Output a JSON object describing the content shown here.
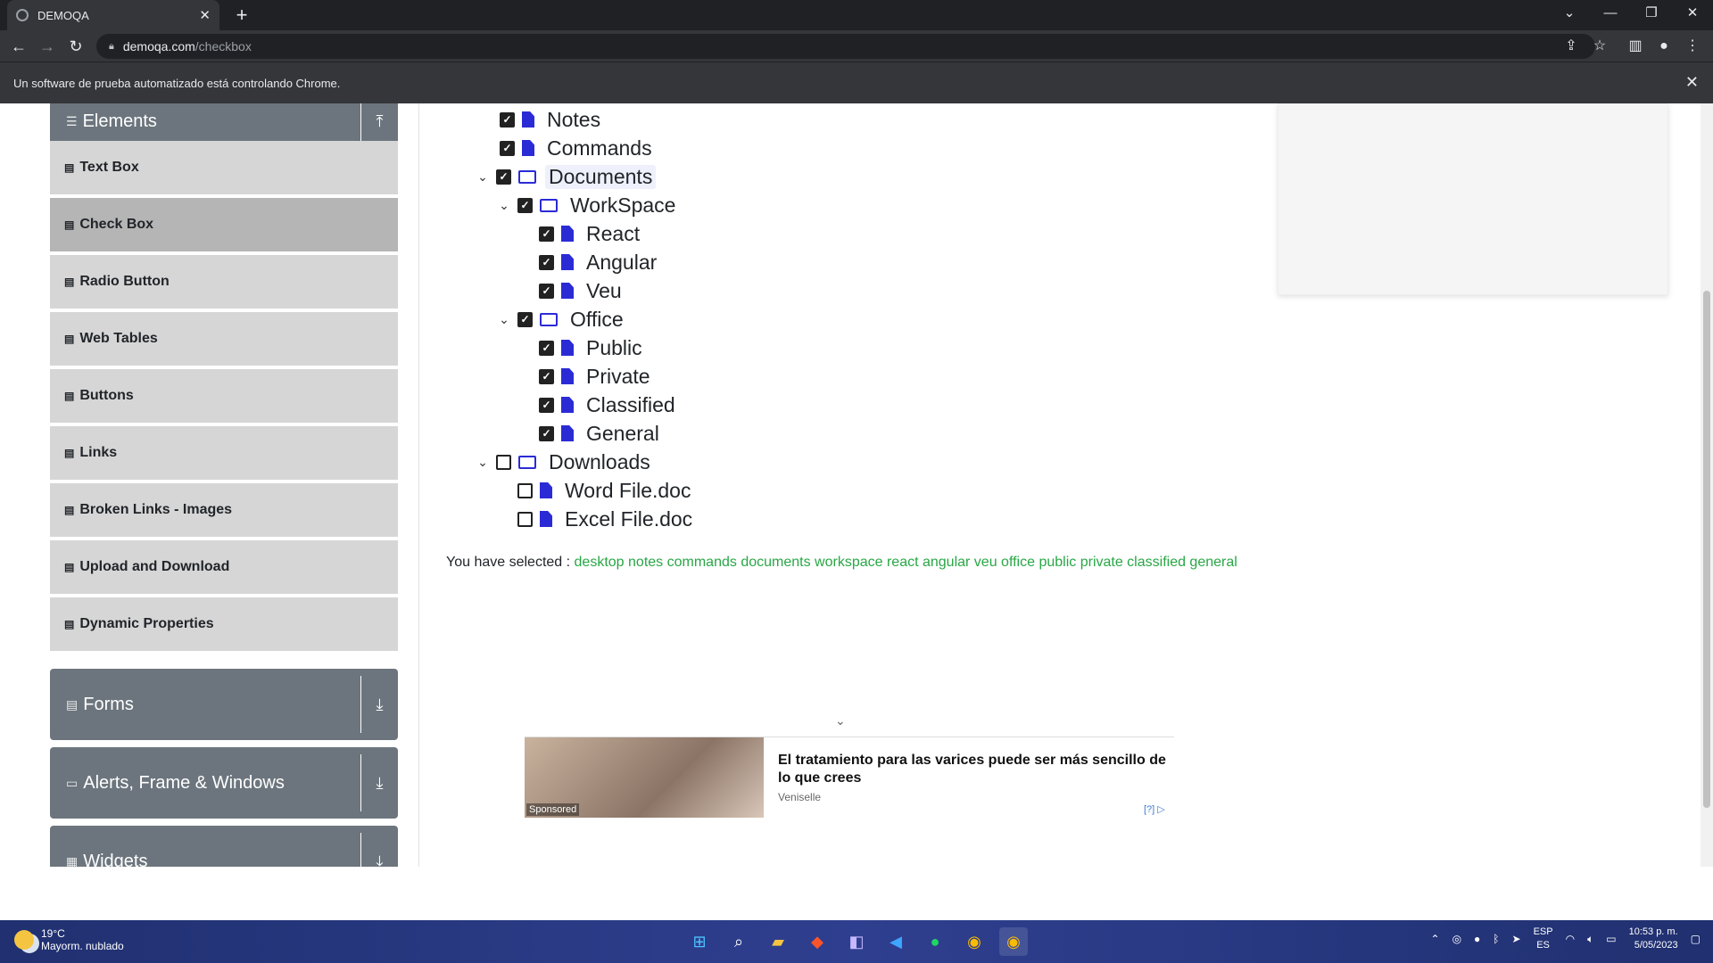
{
  "browser": {
    "tab_title": "DEMOQA",
    "url_host": "demoqa.com",
    "url_path": "/checkbox",
    "infobar_text": "Un software de prueba automatizado está controlando Chrome."
  },
  "sidebar": {
    "elements_header": "Elements",
    "items": [
      {
        "label": "Text Box"
      },
      {
        "label": "Check Box"
      },
      {
        "label": "Radio Button"
      },
      {
        "label": "Web Tables"
      },
      {
        "label": "Buttons"
      },
      {
        "label": "Links"
      },
      {
        "label": "Broken Links - Images"
      },
      {
        "label": "Upload and Download"
      },
      {
        "label": "Dynamic Properties"
      }
    ],
    "groups": [
      {
        "label": "Forms"
      },
      {
        "label": "Alerts, Frame & Windows"
      },
      {
        "label": "Widgets"
      }
    ]
  },
  "tree": {
    "notes": "Notes",
    "commands": "Commands",
    "documents": "Documents",
    "workspace": "WorkSpace",
    "react": "React",
    "angular": "Angular",
    "veu": "Veu",
    "office": "Office",
    "public": "Public",
    "private": "Private",
    "classified": "Classified",
    "general": "General",
    "downloads": "Downloads",
    "word": "Word File.doc",
    "excel": "Excel File.doc"
  },
  "result": {
    "prefix": "You have selected :",
    "selected": [
      "desktop",
      "notes",
      "commands",
      "documents",
      "workspace",
      "react",
      "angular",
      "veu",
      "office",
      "public",
      "private",
      "classified",
      "general"
    ]
  },
  "ad": {
    "title": "El tratamiento para las varices puede ser más sencillo de lo que crees",
    "source": "Veniselle",
    "sponsored": "Sponsored",
    "info": "[?]"
  },
  "taskbar": {
    "temp": "19°C",
    "weather": "Mayorm. nublado",
    "lang1": "ESP",
    "lang2": "ES",
    "time": "10:53 p. m.",
    "date": "5/05/2023"
  }
}
